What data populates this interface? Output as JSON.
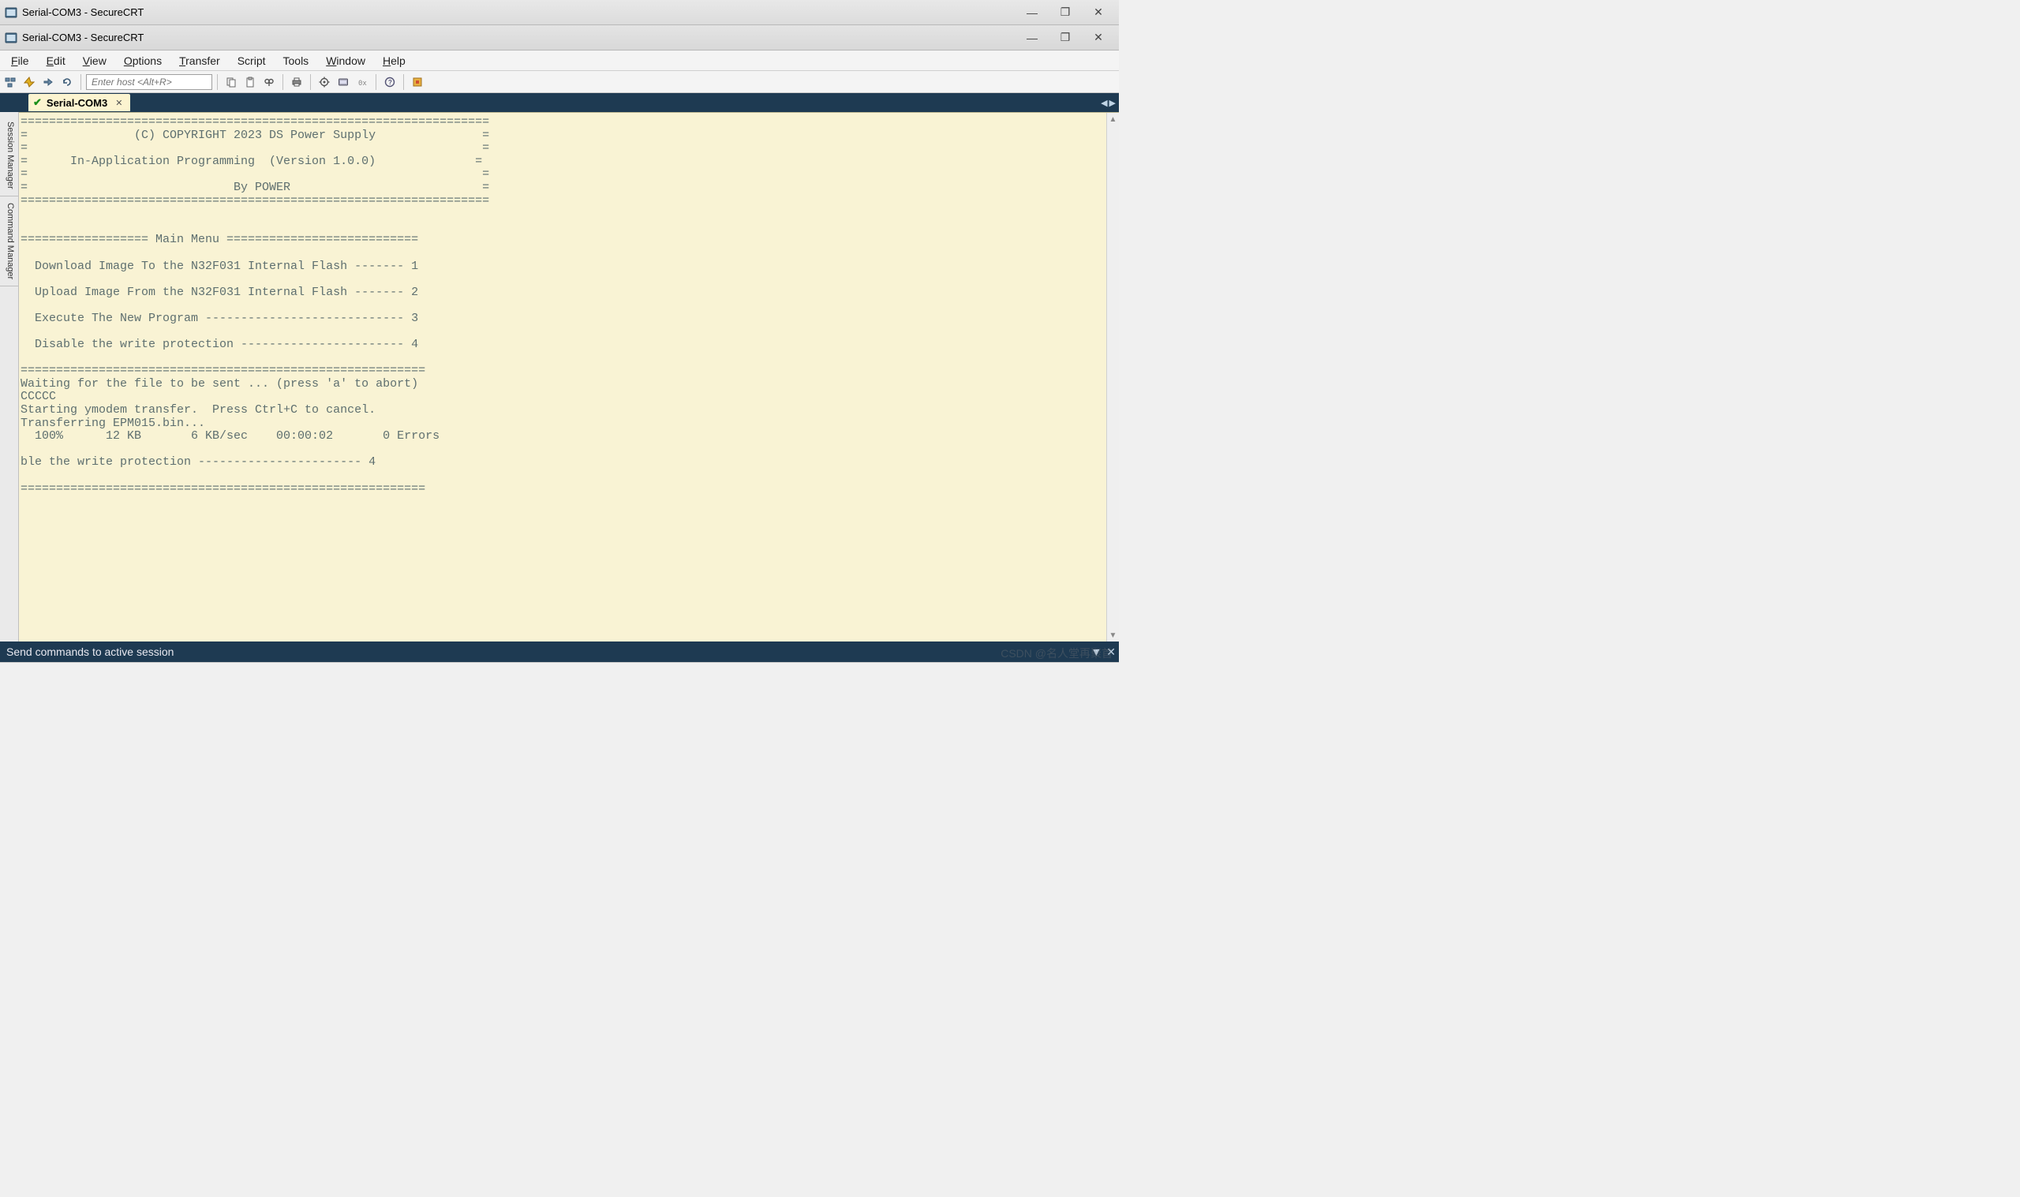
{
  "window1": {
    "title": "Serial-COM3 - SecureCRT"
  },
  "window2": {
    "title": "Serial-COM3 - SecureCRT"
  },
  "menu": {
    "file": "File",
    "edit": "Edit",
    "view": "View",
    "options": "Options",
    "transfer": "Transfer",
    "script": "Script",
    "tools": "Tools",
    "window": "Window",
    "help": "Help"
  },
  "toolbar": {
    "host_placeholder": "Enter host <Alt+R>"
  },
  "tabs": {
    "active": "Serial-COM3"
  },
  "sidetabs": {
    "session_manager": "Session Manager",
    "command_manager": "Command Manager"
  },
  "terminal_lines": [
    "==================================================================",
    "=               (C) COPYRIGHT 2023 DS Power Supply               =",
    "=                                                                =",
    "=      In-Application Programming  (Version 1.0.0)              =",
    "=                                                                =",
    "=                             By POWER                           =",
    "==================================================================",
    "",
    "",
    "================== Main Menu ===========================",
    "",
    "  Download Image To the N32F031 Internal Flash ------- 1",
    "",
    "  Upload Image From the N32F031 Internal Flash ------- 2",
    "",
    "  Execute The New Program ---------------------------- 3",
    "",
    "  Disable the write protection ----------------------- 4",
    "",
    "=========================================================",
    "Waiting for the file to be sent ... (press 'a' to abort)",
    "CCCCC",
    "Starting ymodem transfer.  Press Ctrl+C to cancel.",
    "Transferring EPM015.bin...",
    "  100%      12 KB       6 KB/sec    00:00:02       0 Errors",
    "",
    "ble the write protection ----------------------- 4",
    "",
    "========================================================="
  ],
  "command_bar": {
    "placeholder": "Send commands to active session"
  },
  "watermark": "CSDN @名人堂再聚首"
}
